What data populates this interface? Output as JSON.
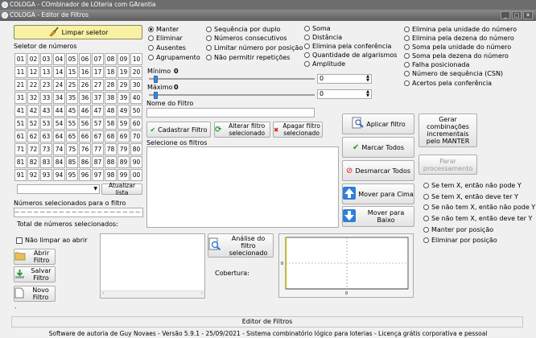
{
  "outer_window": {
    "title": "COLOGA - COmbinador de LOteria com GArantia"
  },
  "window": {
    "title": "COLOGA - Editor de Filtros"
  },
  "left": {
    "clear_button": "Limpar seletor",
    "selector_label": "Seletor de números",
    "numbers": [
      "01",
      "02",
      "03",
      "04",
      "05",
      "06",
      "07",
      "08",
      "09",
      "10",
      "11",
      "12",
      "13",
      "14",
      "15",
      "16",
      "17",
      "18",
      "19",
      "20",
      "21",
      "22",
      "23",
      "24",
      "25",
      "26",
      "27",
      "28",
      "29",
      "30",
      "31",
      "32",
      "33",
      "34",
      "35",
      "36",
      "37",
      "38",
      "39",
      "40",
      "41",
      "42",
      "43",
      "44",
      "45",
      "46",
      "47",
      "48",
      "49",
      "50",
      "51",
      "52",
      "53",
      "54",
      "55",
      "56",
      "57",
      "58",
      "59",
      "60",
      "61",
      "62",
      "63",
      "64",
      "65",
      "66",
      "67",
      "68",
      "69",
      "70",
      "71",
      "72",
      "73",
      "74",
      "75",
      "76",
      "77",
      "78",
      "79",
      "80",
      "81",
      "82",
      "83",
      "84",
      "85",
      "86",
      "87",
      "88",
      "89",
      "90",
      "91",
      "92",
      "93",
      "94",
      "95",
      "96",
      "97",
      "98",
      "99",
      "00"
    ],
    "update_list_button": "Atualizar lista",
    "selected_label": "Números selecionados para o filtro",
    "selected_dashes": "— — — — — — — — — — — — — — — — — — — — —",
    "total_label": "Total de números selecionados:",
    "total_value": "."
  },
  "modes": [
    {
      "label": "Manter",
      "checked": true
    },
    {
      "label": "Eliminar",
      "checked": false
    },
    {
      "label": "Ausentes",
      "checked": false
    },
    {
      "label": "Agrupamento",
      "checked": false
    }
  ],
  "seq_options": [
    "Sequência por duplo",
    "Números consecutivos",
    "Limitar número por posição",
    "Não permitir repetições"
  ],
  "sum_options": [
    "Soma",
    "Distância",
    "Elimina pela conferência",
    "Quantidade de algarismos",
    "Amplitude"
  ],
  "elim_options": [
    "Elimina pela unidade do número",
    "Elimina pela dezena do número",
    "Soma pela unidade do número",
    "Soma pela dezena do número",
    "Falha posicionada",
    "Número de sequência (CSN)",
    "Acertos pela conferência"
  ],
  "range": {
    "min_label": "Mínimo",
    "min_value": "0",
    "max_label": "Máximo",
    "max_value": "0",
    "spin_min": "0",
    "spin_max": "0"
  },
  "filter": {
    "name_label": "Nome do Filtro",
    "name_value": "",
    "register_button": "Cadastrar Filtro",
    "change_button": "Alterar filtro selecionado",
    "delete_button": "Apagar filtro selecionado",
    "select_label": "Selecione os filtros"
  },
  "actions": {
    "apply": "Aplicar filtro",
    "mark_all": "Marcar Todos",
    "unmark_all": "Desmarcar Todos",
    "move_up": "Mover para Cima",
    "move_down": "Mover para Baixo",
    "generate": "Gerar combinações incrementais pelo MANTER",
    "stop": "Parar processamento"
  },
  "conditions": [
    {
      "label": "Se tem X, então não pode Y",
      "checked": false
    },
    {
      "label": "Se tem X, então deve ter Y",
      "checked": false
    },
    {
      "label": "Se não tem X, então não pode Y",
      "checked": false
    },
    {
      "label": "Se não tem X, então deve ter Y",
      "checked": false
    },
    {
      "label": "Manter por posição",
      "checked": false
    },
    {
      "label": "Eliminar por posição",
      "checked": false
    }
  ],
  "bottom": {
    "no_clear": "Não limpar ao abrir",
    "open": "Abrir Filtro",
    "save": "Salvar Filtro",
    "new": "Novo Filtro",
    "analyze": "Análise do filtro selecionado",
    "coverage_label": "Cobertura:",
    "dot": "."
  },
  "chart_data": {
    "type": "line",
    "x_tick": "0",
    "y_tick": "0",
    "series": []
  },
  "status": {
    "text": "Editor de Filtros",
    "footer": "Software de autoria de Guy Novaes - Versão 5.9.1 - 25/09/2021 - Sistema combinatório lógico para loterias - Licença grátis corporativa e pessoal"
  },
  "colors": {
    "titlebar": "#6d6d6d",
    "selector_button": "#f8f1a4",
    "thumb": "#3a8de0"
  }
}
